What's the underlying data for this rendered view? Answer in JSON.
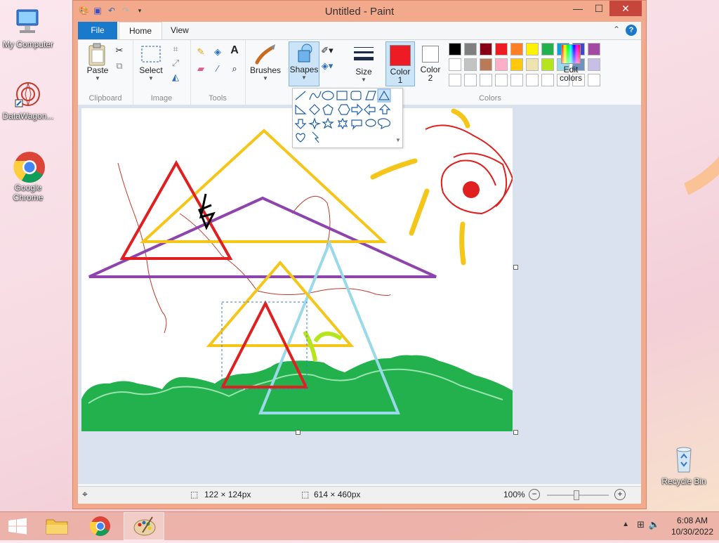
{
  "desktop": {
    "icons": [
      {
        "label": "My Computer",
        "icon": "computer-icon"
      },
      {
        "label": "DataWagon...",
        "icon": "datawagon-icon"
      },
      {
        "label": "Google Chrome",
        "icon": "chrome-icon"
      },
      {
        "label": "Recycle Bin",
        "icon": "recycle-bin-icon"
      }
    ]
  },
  "window": {
    "title": "Untitled - Paint",
    "minimize": "—",
    "maximize": "☐",
    "close": "✕"
  },
  "tabs": [
    {
      "label": "File"
    },
    {
      "label": "Home"
    },
    {
      "label": "View"
    }
  ],
  "ribbon": {
    "clipboard": {
      "paste": "Paste",
      "group": "Clipboard"
    },
    "image": {
      "select": "Select",
      "group": "Image"
    },
    "tools": {
      "group": "Tools"
    },
    "brushes": "Brushes",
    "shapes": "Shapes",
    "size": "Size",
    "color1": "Color\n1",
    "color2": "Color\n2",
    "colors_group": "Colors",
    "edit_colors": "Edit\ncolors",
    "color1_value": "#ed1c24",
    "color2_value": "#ffffff",
    "palette_row1": [
      "#000000",
      "#7f7f7f",
      "#880015",
      "#ed1c24",
      "#ff7f27",
      "#fff200",
      "#22b14c",
      "#00a2e8",
      "#3f48cc",
      "#a349a4"
    ],
    "palette_row2": [
      "#ffffff",
      "#c3c3c3",
      "#b97a57",
      "#ffaec9",
      "#ffc90e",
      "#efe4b0",
      "#b5e61d",
      "#99d9ea",
      "#7092be",
      "#c8bfe7"
    ]
  },
  "status": {
    "selection_size": "122 × 124px",
    "image_size": "614 × 460px",
    "zoom": "100%"
  },
  "taskbar": {
    "time": "6:08 AM",
    "date": "10/30/2022"
  }
}
